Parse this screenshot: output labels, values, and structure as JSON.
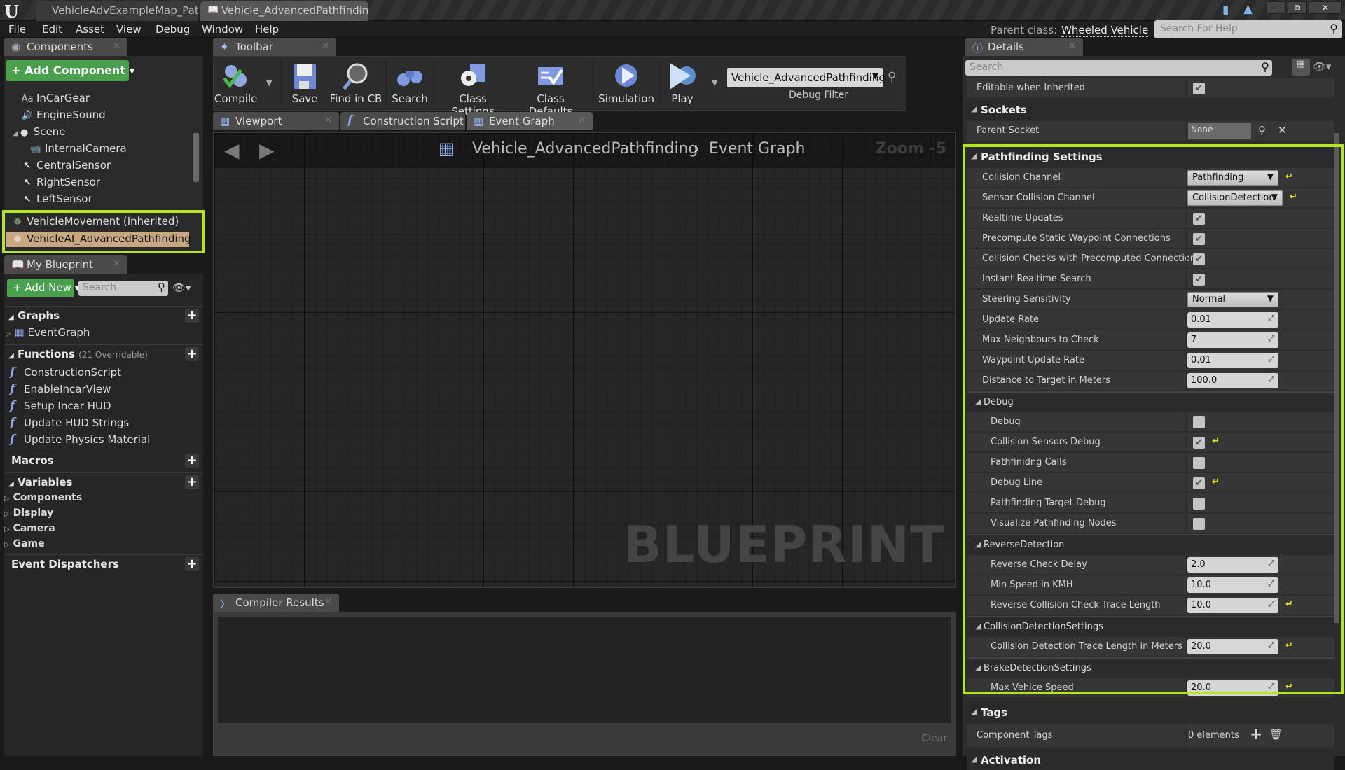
{
  "window": {
    "doc_tabs": [
      "VehicleAdvExampleMap_Path",
      "Vehicle_AdvancedPathfinding"
    ],
    "controls": [
      "minimize",
      "restore",
      "close"
    ]
  },
  "menu": {
    "items": [
      "File",
      "Edit",
      "Asset",
      "View",
      "Debug",
      "Window",
      "Help"
    ],
    "parent_class_label": "Parent class:",
    "parent_class_value": "Wheeled Vehicle",
    "help_search_placeholder": "Search For Help"
  },
  "components": {
    "tab_label": "Components",
    "add_button": "+ Add Component ▾",
    "items": [
      {
        "label": "InCarGear",
        "icon": "text-render-icon"
      },
      {
        "label": "EngineSound",
        "icon": "audio-icon"
      },
      {
        "label": "Scene",
        "icon": "scene-icon"
      },
      {
        "label": "InternalCamera",
        "icon": "camera-icon"
      },
      {
        "label": "CentralSensor",
        "icon": "arrow-icon"
      },
      {
        "label": "RightSensor",
        "icon": "arrow-icon"
      },
      {
        "label": "LeftSensor",
        "icon": "arrow-icon"
      }
    ],
    "highlighted": [
      {
        "label": "VehicleMovement (Inherited)"
      },
      {
        "label": "VehicleAI_AdvancedPathfinding",
        "selected": true
      }
    ]
  },
  "my_blueprint": {
    "tab_label": "My Blueprint",
    "add_new": "+ Add New ▾",
    "search_placeholder": "Search",
    "graphs_header": "Graphs",
    "graphs": [
      "EventGraph"
    ],
    "functions_header": "Functions",
    "functions_count": "(21 Overridable)",
    "functions": [
      "ConstructionScript",
      "EnableIncarView",
      "Setup Incar HUD",
      "Update HUD Strings",
      "Update Physics Material"
    ],
    "macros_header": "Macros",
    "variables_header": "Variables",
    "variables": [
      "Components",
      "Display",
      "Camera",
      "Game"
    ],
    "dispatchers_header": "Event Dispatchers"
  },
  "toolbar": {
    "tab_label": "Toolbar",
    "buttons": [
      "Compile",
      "Save",
      "Find in CB",
      "Search",
      "Class Settings",
      "Class Defaults",
      "Simulation",
      "Play"
    ],
    "debug_object": "Vehicle_AdvancedPathfinding",
    "debug_filter_label": "Debug Filter"
  },
  "editor_tabs": [
    "Viewport",
    "Construction Script",
    "Event Graph"
  ],
  "graph": {
    "breadcrumb_bp": "Vehicle_AdvancedPathfinding",
    "breadcrumb_sep": "›",
    "breadcrumb_graph": "Event Graph",
    "zoom": "Zoom -5",
    "watermark": "BLUEPRINT"
  },
  "compiler": {
    "tab_label": "Compiler Results",
    "clear_label": "Clear"
  },
  "details": {
    "tab_label": "Details",
    "search_placeholder": "Search",
    "editable_when_inherited": {
      "label": "Editable when Inherited",
      "checked": true
    },
    "sockets_header": "Sockets",
    "parent_socket": {
      "label": "Parent Socket",
      "value": "None"
    },
    "pathfinding_header": "Pathfinding Settings",
    "pathfinding": [
      {
        "label": "Collision Channel",
        "type": "combo",
        "value": "Pathfinding",
        "reset": true
      },
      {
        "label": "Sensor Collision Channel",
        "type": "combo",
        "value": "CollisionDetection",
        "reset": true
      },
      {
        "label": "Realtime Updates",
        "type": "check",
        "checked": true
      },
      {
        "label": "Precompute Static Waypoint Connections",
        "type": "check",
        "checked": true
      },
      {
        "label": "Collision Checks with Precomputed Connection",
        "type": "check",
        "checked": true
      },
      {
        "label": "Instant Realtime Search",
        "type": "check",
        "checked": true
      },
      {
        "label": "Steering Sensitivity",
        "type": "combo",
        "value": "Normal"
      },
      {
        "label": "Update Rate",
        "type": "num",
        "value": "0.01"
      },
      {
        "label": "Max Neighbours to Check",
        "type": "num",
        "value": "7"
      },
      {
        "label": "Waypoint Update Rate",
        "type": "num",
        "value": "0.01"
      },
      {
        "label": "Distance to Target in Meters",
        "type": "num",
        "value": "100.0"
      }
    ],
    "debug_header": "Debug",
    "debug": [
      {
        "label": "Debug",
        "checked": false
      },
      {
        "label": "Collision Sensors Debug",
        "checked": true,
        "reset": true
      },
      {
        "label": "Pathfinidng Calls",
        "checked": false
      },
      {
        "label": "Debug Line",
        "checked": true,
        "reset": true
      },
      {
        "label": "Pathfinding Target Debug",
        "checked": false
      },
      {
        "label": "Visualize Pathfinding Nodes",
        "checked": false
      }
    ],
    "reverse_header": "ReverseDetection",
    "reverse": [
      {
        "label": "Reverse Check Delay",
        "value": "2.0"
      },
      {
        "label": "Min Speed in KMH",
        "value": "10.0"
      },
      {
        "label": "Reverse Collision Check Trace Length",
        "value": "10.0",
        "reset": true
      }
    ],
    "collision_header": "CollisionDetectionSettings",
    "collision": [
      {
        "label": "Collision Detection Trace Length in Meters",
        "value": "20.0",
        "reset": true
      }
    ],
    "brake_header": "BrakeDetectionSettings",
    "brake": [
      {
        "label": "Max Vehice Speed",
        "value": "20.0",
        "reset": true
      }
    ],
    "tags_header": "Tags",
    "component_tags": {
      "label": "Component Tags",
      "value": "0 elements"
    },
    "activation_header": "Activation"
  },
  "colors": {
    "highlight": "#b5e61d",
    "add_green": "#48a04d",
    "reset_yellow": "#e6e01c",
    "selected_row": "#c8a882"
  }
}
